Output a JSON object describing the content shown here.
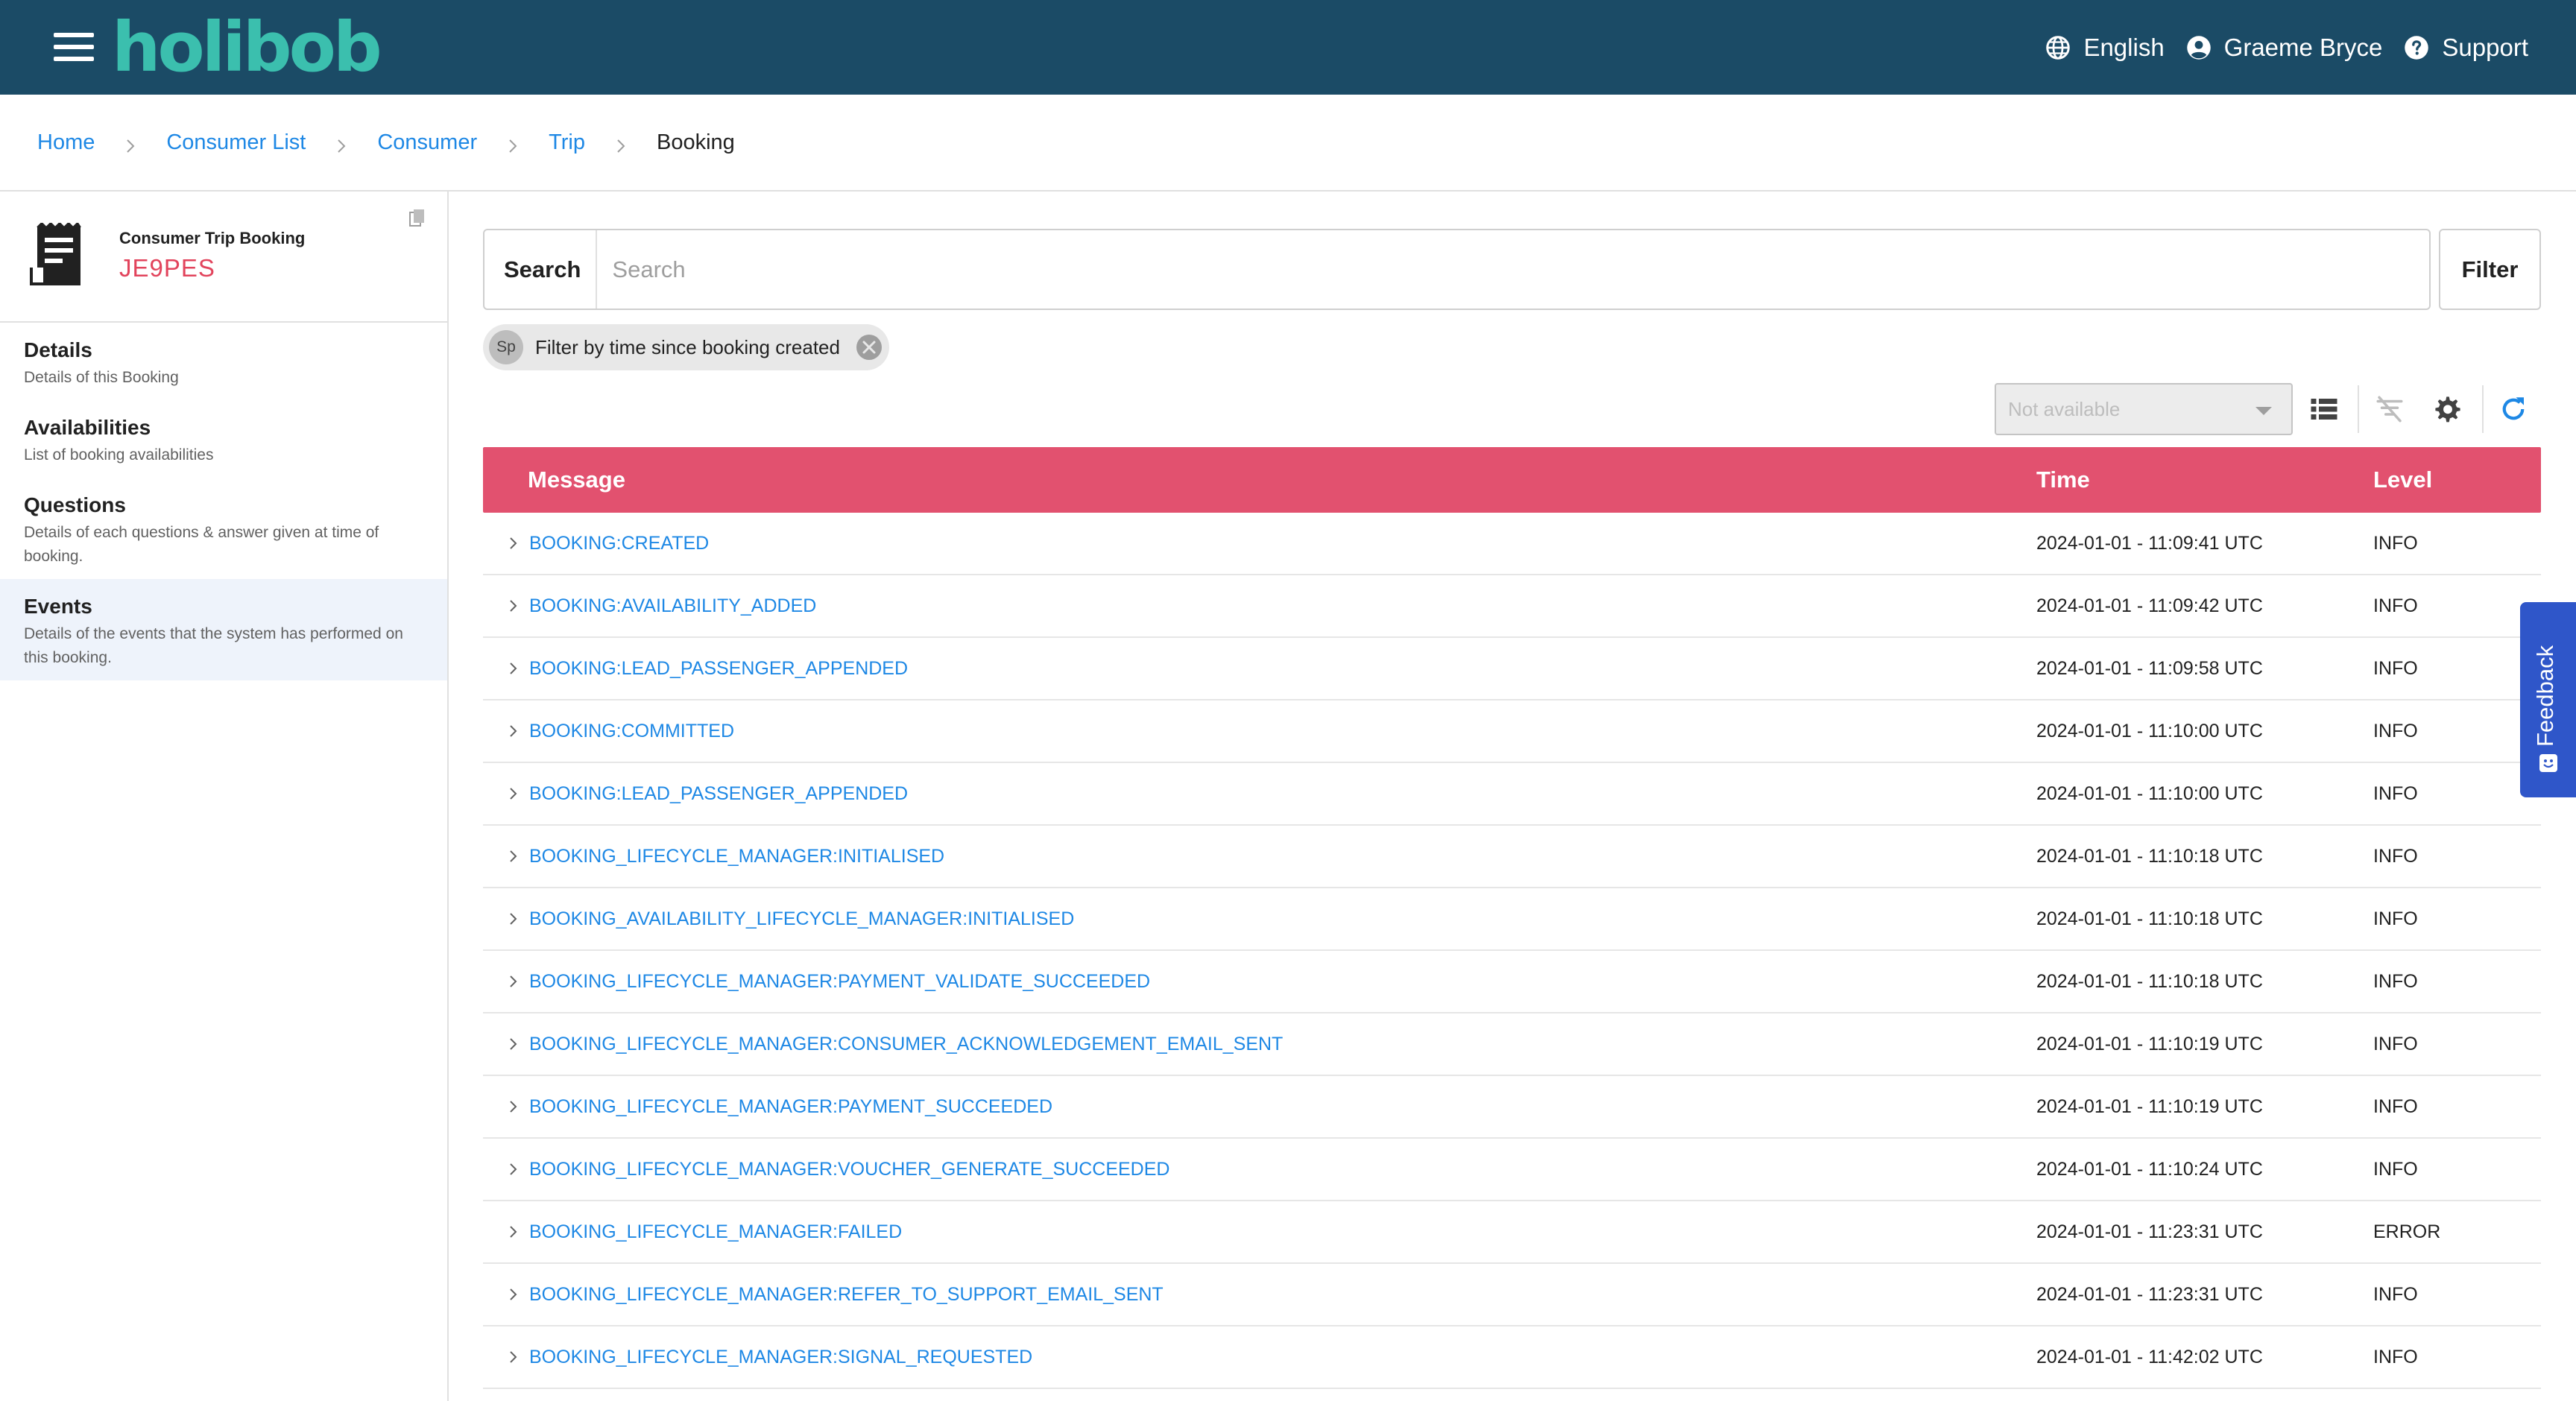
{
  "header": {
    "logo": "holibob",
    "language": "English",
    "user": "Graeme Bryce",
    "support": "Support"
  },
  "breadcrumb": {
    "items": [
      "Home",
      "Consumer List",
      "Consumer",
      "Trip"
    ],
    "current": "Booking"
  },
  "sidebar": {
    "title": "Consumer Trip Booking",
    "code": "JE9PES",
    "items": [
      {
        "label": "Details",
        "desc": "Details of this Booking"
      },
      {
        "label": "Availabilities",
        "desc": "List of booking availabilities"
      },
      {
        "label": "Questions",
        "desc": "Details of each questions & answer given at time of booking."
      },
      {
        "label": "Events",
        "desc": "Details of the events that the system has performed on this booking."
      }
    ],
    "active": "Events"
  },
  "search": {
    "label": "Search",
    "placeholder": "Search",
    "filter_label": "Filter"
  },
  "chip": {
    "avatar": "Sp",
    "text": "Filter by time since booking created"
  },
  "toolbar": {
    "select_value": "Not available"
  },
  "table": {
    "headers": {
      "message": "Message",
      "time": "Time",
      "level": "Level"
    },
    "rows": [
      {
        "message": "BOOKING:CREATED",
        "time": "2024-01-01 - 11:09:41 UTC",
        "level": "INFO"
      },
      {
        "message": "BOOKING:AVAILABILITY_ADDED",
        "time": "2024-01-01 - 11:09:42 UTC",
        "level": "INFO"
      },
      {
        "message": "BOOKING:LEAD_PASSENGER_APPENDED",
        "time": "2024-01-01 - 11:09:58 UTC",
        "level": "INFO"
      },
      {
        "message": "BOOKING:COMMITTED",
        "time": "2024-01-01 - 11:10:00 UTC",
        "level": "INFO"
      },
      {
        "message": "BOOKING:LEAD_PASSENGER_APPENDED",
        "time": "2024-01-01 - 11:10:00 UTC",
        "level": "INFO"
      },
      {
        "message": "BOOKING_LIFECYCLE_MANAGER:INITIALISED",
        "time": "2024-01-01 - 11:10:18 UTC",
        "level": "INFO"
      },
      {
        "message": "BOOKING_AVAILABILITY_LIFECYCLE_MANAGER:INITIALISED",
        "time": "2024-01-01 - 11:10:18 UTC",
        "level": "INFO"
      },
      {
        "message": "BOOKING_LIFECYCLE_MANAGER:PAYMENT_VALIDATE_SUCCEEDED",
        "time": "2024-01-01 - 11:10:18 UTC",
        "level": "INFO"
      },
      {
        "message": "BOOKING_LIFECYCLE_MANAGER:CONSUMER_ACKNOWLEDGEMENT_EMAIL_SENT",
        "time": "2024-01-01 - 11:10:19 UTC",
        "level": "INFO"
      },
      {
        "message": "BOOKING_LIFECYCLE_MANAGER:PAYMENT_SUCCEEDED",
        "time": "2024-01-01 - 11:10:19 UTC",
        "level": "INFO"
      },
      {
        "message": "BOOKING_LIFECYCLE_MANAGER:VOUCHER_GENERATE_SUCCEEDED",
        "time": "2024-01-01 - 11:10:24 UTC",
        "level": "INFO"
      },
      {
        "message": "BOOKING_LIFECYCLE_MANAGER:FAILED",
        "time": "2024-01-01 - 11:23:31 UTC",
        "level": "ERROR"
      },
      {
        "message": "BOOKING_LIFECYCLE_MANAGER:REFER_TO_SUPPORT_EMAIL_SENT",
        "time": "2024-01-01 - 11:23:31 UTC",
        "level": "INFO"
      },
      {
        "message": "BOOKING_LIFECYCLE_MANAGER:SIGNAL_REQUESTED",
        "time": "2024-01-01 - 11:42:02 UTC",
        "level": "INFO"
      }
    ]
  },
  "feedback": {
    "label": "Feedback"
  },
  "icons": {
    "menu": "hamburger-menu-icon",
    "language": "globe-icon",
    "user": "account-circle-icon",
    "support": "help-circle-icon",
    "booking": "receipt-icon",
    "copy": "copy-icon",
    "list": "list-view-icon",
    "filter_off": "filter-off-icon",
    "settings": "gear-icon",
    "refresh": "refresh-icon",
    "expand": "chevron-right-icon"
  },
  "colors": {
    "topbar": "#1b4b66",
    "logo": "#3bbfae",
    "table_header": "#e2516f",
    "link": "#1e88e5",
    "booking_code": "#e2445c",
    "feedback": "#2f56c9"
  }
}
